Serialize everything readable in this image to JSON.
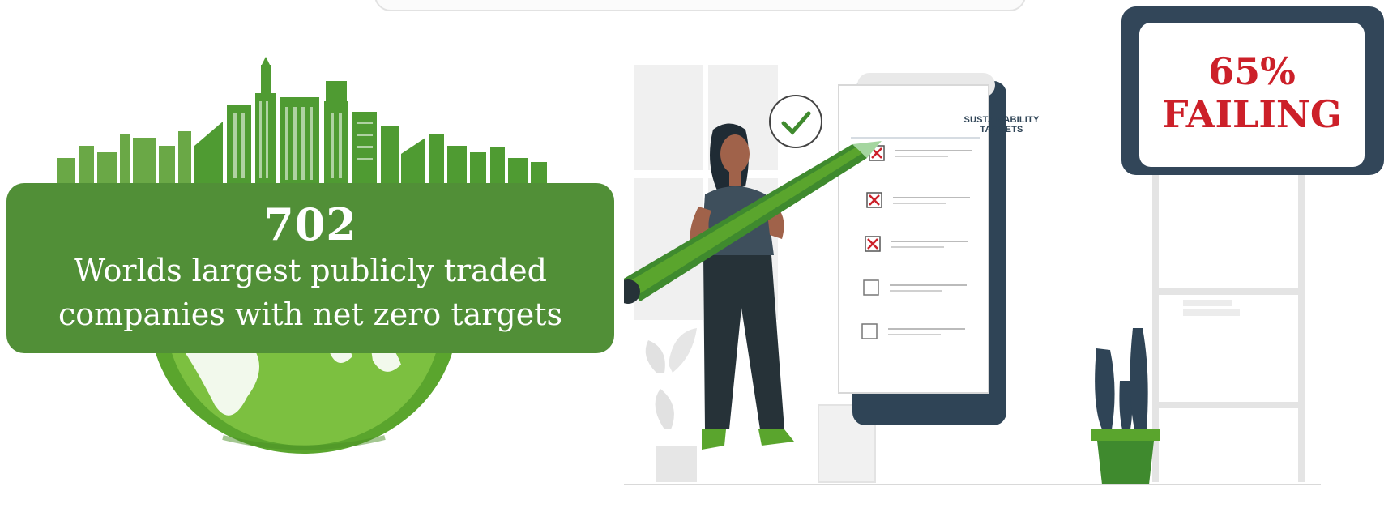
{
  "stat": {
    "value": "702",
    "caption_line1": "Worlds largest publicly traded",
    "caption_line2": "companies with net zero targets"
  },
  "failing": {
    "percent": "65%",
    "label": "FAILING"
  },
  "checklist": {
    "title": "SUSTAINABILITY TARGETS",
    "items": [
      {
        "state": "failed"
      },
      {
        "state": "failed"
      },
      {
        "state": "failed"
      },
      {
        "state": "empty"
      },
      {
        "state": "empty"
      }
    ]
  },
  "colors": {
    "green": "#518f37",
    "light_green": "#7cc040",
    "navy": "#324659",
    "red": "#cc2029"
  },
  "icons": [
    "city-skyline-icon",
    "globe-icon",
    "checkmark-bubble-icon",
    "pencil-icon",
    "cactus-icon",
    "plant-icon"
  ]
}
